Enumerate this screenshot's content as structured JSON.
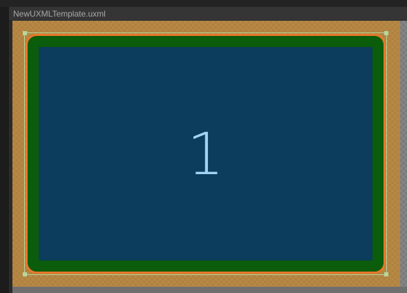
{
  "window": {
    "title": "NewUXMLTemplate.uxml"
  },
  "canvas": {
    "element_text": "1"
  },
  "colors": {
    "margin": "#c48c3c",
    "border": "#e8772a",
    "padding": "#0b5c0b",
    "content": "#0c3d5c",
    "text": "#a3d3f5",
    "selection": "#b7d69a"
  }
}
